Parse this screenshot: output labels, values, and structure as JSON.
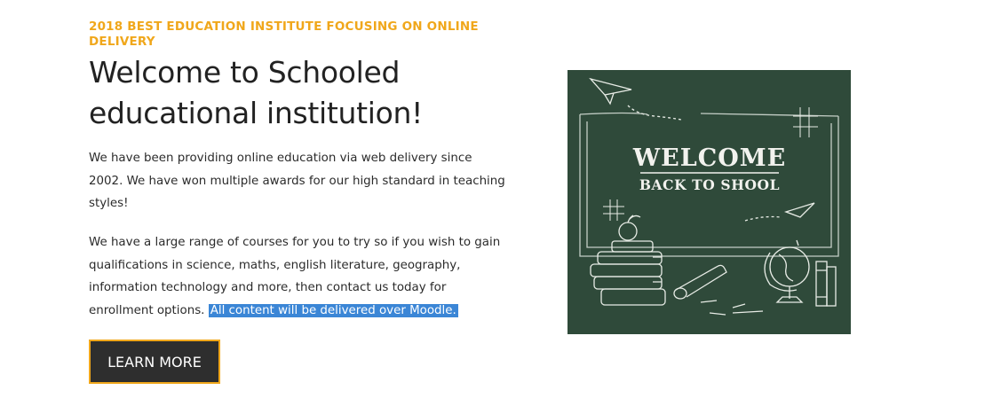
{
  "hero": {
    "eyebrow": "2018 BEST EDUCATION INSTITUTE FOCUSING ON ONLINE DELIVERY",
    "title": "Welcome to Schooled educational institution!",
    "paragraph1": "We have been providing online education via web delivery since 2002. We have won multiple awards for our high standard in teaching styles!",
    "paragraph2": "We have a large range of courses for you to try so if you wish to gain qualifications in science, maths, english literature, geography, information technology and more, then contact us today for enrollment options.",
    "paragraph2_selected": "All content will be delivered over Moodle.",
    "button_label": "LEARN MORE"
  },
  "image": {
    "line1": "WELCOME",
    "line2": "BACK TO SHOOL"
  },
  "colors": {
    "accent": "#f0a71b",
    "button_bg": "#2e2e2e",
    "selection": "#3b86d6",
    "chalkboard": "#2f4a3a"
  }
}
